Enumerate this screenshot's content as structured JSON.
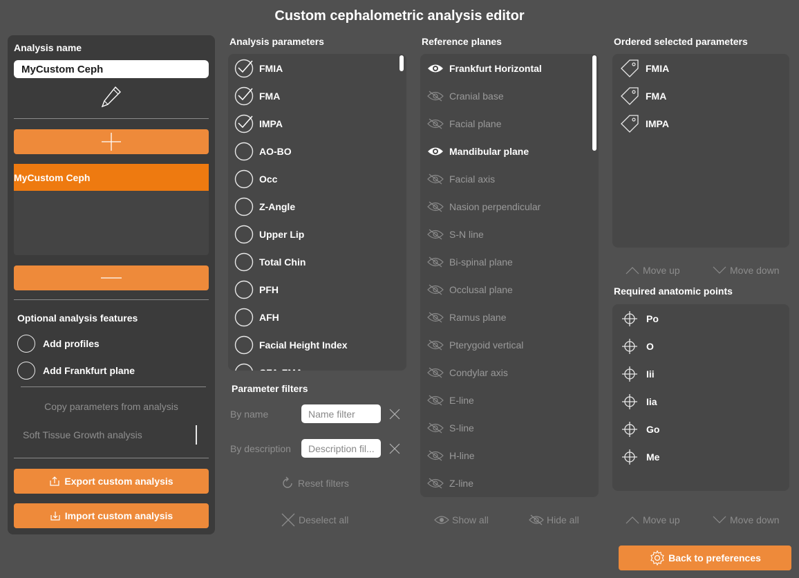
{
  "window": {
    "title": "Custom cephalometric analysis editor"
  },
  "left": {
    "analysis_name_label": "Analysis name",
    "analysis_name_value": "MyCustom Ceph",
    "analyses": [
      "MyCustom Ceph"
    ],
    "optional_features_label": "Optional analysis features",
    "features": [
      {
        "label": "Add profiles",
        "checked": false
      },
      {
        "label": "Add Frankfurt plane",
        "checked": false
      }
    ],
    "copy_label": "Copy parameters from analysis",
    "copy_source": "Soft Tissue Growth analysis",
    "export_label": "Export custom analysis",
    "import_label": "Import custom analysis"
  },
  "parameters": {
    "header": "Analysis parameters",
    "items": [
      {
        "label": "FMIA",
        "checked": true
      },
      {
        "label": "FMA",
        "checked": true
      },
      {
        "label": "IMPA",
        "checked": true
      },
      {
        "label": "AO-BO",
        "checked": false
      },
      {
        "label": "Occ",
        "checked": false
      },
      {
        "label": "Z-Angle",
        "checked": false
      },
      {
        "label": "Upper Lip",
        "checked": false
      },
      {
        "label": "Total Chin",
        "checked": false
      },
      {
        "label": "PFH",
        "checked": false
      },
      {
        "label": "AFH",
        "checked": false
      },
      {
        "label": "Facial Height Index",
        "checked": false
      },
      {
        "label": "CFA-FMA",
        "checked": false
      }
    ],
    "filters_header": "Parameter filters",
    "by_name_label": "By name",
    "name_placeholder": "Name filter",
    "by_description_label": "By description",
    "description_placeholder": "Description fil...",
    "reset_label": "Reset filters",
    "deselect_label": "Deselect all"
  },
  "planes": {
    "header": "Reference planes",
    "items": [
      {
        "label": "Frankfurt Horizontal",
        "visible": true
      },
      {
        "label": "Cranial base",
        "visible": false
      },
      {
        "label": "Facial plane",
        "visible": false
      },
      {
        "label": "Mandibular plane",
        "visible": true
      },
      {
        "label": "Facial axis",
        "visible": false
      },
      {
        "label": "Nasion perpendicular",
        "visible": false
      },
      {
        "label": "S-N line",
        "visible": false
      },
      {
        "label": "Bi-spinal plane",
        "visible": false
      },
      {
        "label": "Occlusal plane",
        "visible": false
      },
      {
        "label": "Ramus plane",
        "visible": false
      },
      {
        "label": "Pterygoid vertical",
        "visible": false
      },
      {
        "label": "Condylar axis",
        "visible": false
      },
      {
        "label": "E-line",
        "visible": false
      },
      {
        "label": "S-line",
        "visible": false
      },
      {
        "label": "H-line",
        "visible": false
      },
      {
        "label": "Z-line",
        "visible": false
      }
    ],
    "show_all_label": "Show all",
    "hide_all_label": "Hide all"
  },
  "ordered": {
    "header": "Ordered selected parameters",
    "items": [
      "FMIA",
      "FMA",
      "IMPA"
    ],
    "move_up_label": "Move up",
    "move_down_label": "Move down"
  },
  "points": {
    "header": "Required anatomic points",
    "items": [
      "Po",
      "O",
      "Iii",
      "Iia",
      "Go",
      "Me"
    ],
    "move_up_label": "Move up",
    "move_down_label": "Move down"
  },
  "footer": {
    "back_label": "Back to preferences"
  },
  "colors": {
    "accent": "#ee8a3a",
    "selected": "#ee7a10",
    "background": "#505050"
  }
}
